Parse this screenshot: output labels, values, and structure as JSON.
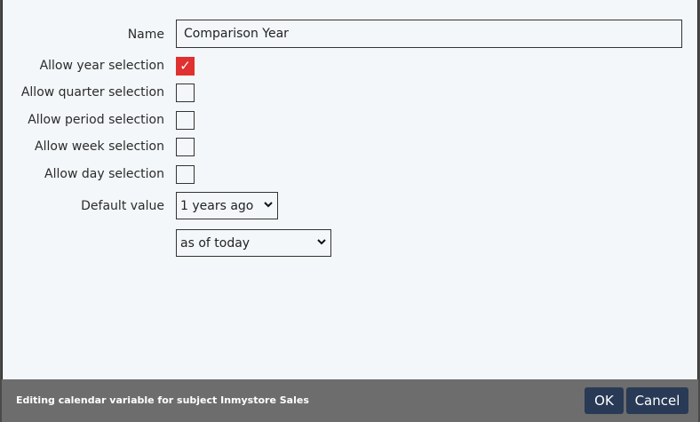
{
  "form": {
    "name_label": "Name",
    "name_value": "Comparison Year",
    "options": [
      {
        "label": "Allow year selection",
        "checked": true
      },
      {
        "label": "Allow quarter selection",
        "checked": false
      },
      {
        "label": "Allow period selection",
        "checked": false
      },
      {
        "label": "Allow week selection",
        "checked": false
      },
      {
        "label": "Allow day selection",
        "checked": false
      }
    ],
    "checkmark": "✓",
    "default_label": "Default value",
    "default_offset": "1 years ago",
    "default_anchor": "as of today",
    "dropdown_icon": "chevron-down-icon"
  },
  "footer": {
    "status": "Editing calendar variable for subject Inmystore Sales",
    "ok_label": "OK",
    "cancel_label": "Cancel"
  },
  "colors": {
    "checked": "#e0302f",
    "button": "#283a55",
    "footer": "#6d6d6d",
    "dialog_bg": "#f3f7fa"
  }
}
